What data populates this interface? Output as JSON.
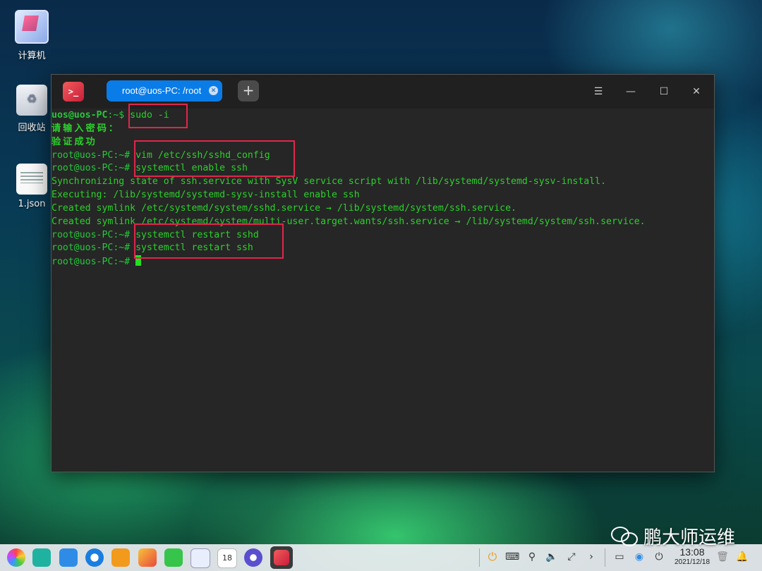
{
  "desktop": {
    "icons": [
      {
        "label": "计算机",
        "icon": "computer-icon"
      },
      {
        "label": "回收站",
        "icon": "trash-icon"
      },
      {
        "label": "1.json",
        "icon": "file-icon"
      }
    ]
  },
  "terminal": {
    "tab_title": "root@uos-PC: /root",
    "lines": [
      {
        "prompt_user": "uos@uos-PC",
        "prompt_tail": ":~$ ",
        "command": "sudo -i",
        "output": ""
      },
      {
        "prompt_user": "",
        "prompt_tail": "",
        "command": "",
        "output": "请输入密码："
      },
      {
        "prompt_user": "",
        "prompt_tail": "",
        "command": "",
        "output": "验证成功"
      },
      {
        "prompt_user": "",
        "prompt_tail": "root@uos-PC:~# ",
        "command": "vim /etc/ssh/sshd_config",
        "output": ""
      },
      {
        "prompt_user": "",
        "prompt_tail": "root@uos-PC:~# ",
        "command": "systemctl enable ssh",
        "output": ""
      },
      {
        "prompt_user": "",
        "prompt_tail": "",
        "command": "",
        "output": "Synchronizing state of ssh.service with SysV service script with /lib/systemd/systemd-sysv-install."
      },
      {
        "prompt_user": "",
        "prompt_tail": "",
        "command": "",
        "output": "Executing: /lib/systemd/systemd-sysv-install enable ssh"
      },
      {
        "prompt_user": "",
        "prompt_tail": "",
        "command": "",
        "output": "Created symlink /etc/systemd/system/sshd.service → /lib/systemd/system/ssh.service."
      },
      {
        "prompt_user": "",
        "prompt_tail": "",
        "command": "",
        "output": "Created symlink /etc/systemd/system/multi-user.target.wants/ssh.service → /lib/systemd/system/ssh.service."
      },
      {
        "prompt_user": "",
        "prompt_tail": "root@uos-PC:~# ",
        "command": "systemctl restart sshd",
        "output": ""
      },
      {
        "prompt_user": "",
        "prompt_tail": "root@uos-PC:~# ",
        "command": "systemctl restart ssh",
        "output": ""
      },
      {
        "prompt_user": "",
        "prompt_tail": "root@uos-PC:~# ",
        "command": "",
        "output": ""
      }
    ]
  },
  "taskbar": {
    "clock_time": "13:08",
    "clock_date": "2021/12/18",
    "calendar_day": "18",
    "apps": [
      "launcher-icon",
      "multitask-view-icon",
      "app-store-icon",
      "browser-icon",
      "music-icon",
      "photos-icon",
      "music-player-icon",
      "documents-icon",
      "calendar-icon",
      "settings-icon",
      "terminal-icon"
    ]
  },
  "watermark": {
    "text": "鹏大师运维"
  },
  "colors": {
    "tab_active": "#0a7ce8",
    "highlight_box": "#e1264a",
    "terminal_green": "#2bd12b"
  }
}
